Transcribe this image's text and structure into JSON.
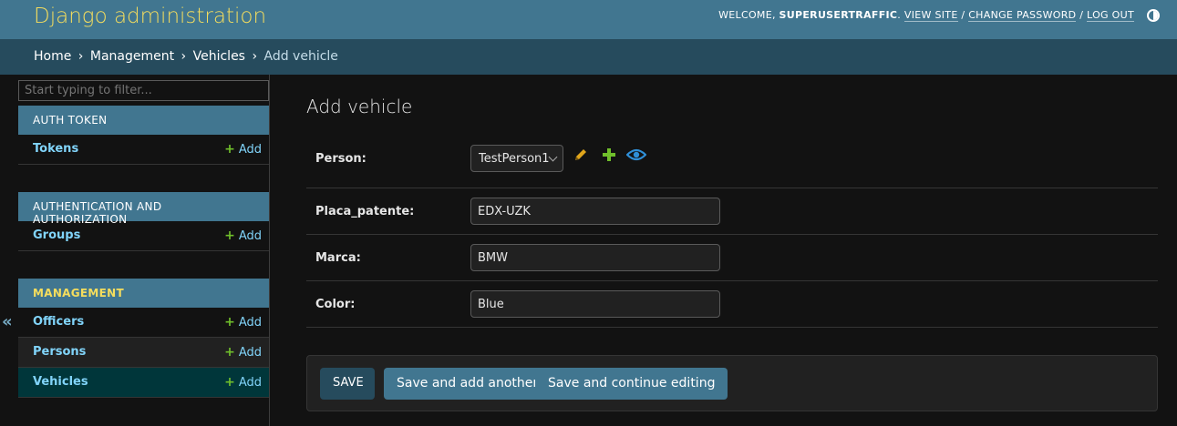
{
  "header": {
    "branding": "Django administration",
    "welcome": "WELCOME, ",
    "username": "SUPERUSERTRAFFIC",
    "period": ". ",
    "view_site": "VIEW SITE",
    "sep1": " / ",
    "change_password": "CHANGE PASSWORD",
    "sep2": " / ",
    "log_out": "LOG OUT",
    "theme_icon": "contrast-icon"
  },
  "breadcrumbs": {
    "home": "Home",
    "app": "Management",
    "model": "Vehicles",
    "current": "Add vehicle",
    "separator": "›"
  },
  "sidebar": {
    "collapse_label": "«",
    "filter_placeholder": "Start typing to filter...",
    "add_label": "Add",
    "modules": [
      {
        "caption": "AUTH TOKEN",
        "models": [
          {
            "name": "Tokens"
          }
        ]
      },
      {
        "caption": "AUTHENTICATION AND AUTHORIZATION",
        "models": [
          {
            "name": "Groups"
          }
        ]
      },
      {
        "caption": "MANAGEMENT",
        "models": [
          {
            "name": "Officers"
          },
          {
            "name": "Persons"
          },
          {
            "name": "Vehicles"
          }
        ]
      }
    ]
  },
  "form": {
    "title": "Add vehicle",
    "person": {
      "label": "Person:",
      "value": "TestPerson1"
    },
    "placa": {
      "label": "Placa_patente:",
      "value": "EDX-UZK"
    },
    "marca": {
      "label": "Marca:",
      "value": "BMW"
    },
    "color": {
      "label": "Color:",
      "value": "Blue"
    }
  },
  "buttons": {
    "save": "SAVE",
    "save_add_another": "Save and add another",
    "save_continue": "Save and continue editing"
  },
  "colors": {
    "header_bg": "#417690",
    "breadcrumbs_bg": "#264b5d",
    "branding": "#f5dd5d",
    "link": "#81d4fa",
    "add_plus": "#70bf2b",
    "edit_icon": "#e0a51b",
    "view_icon": "#2f8fd8"
  }
}
